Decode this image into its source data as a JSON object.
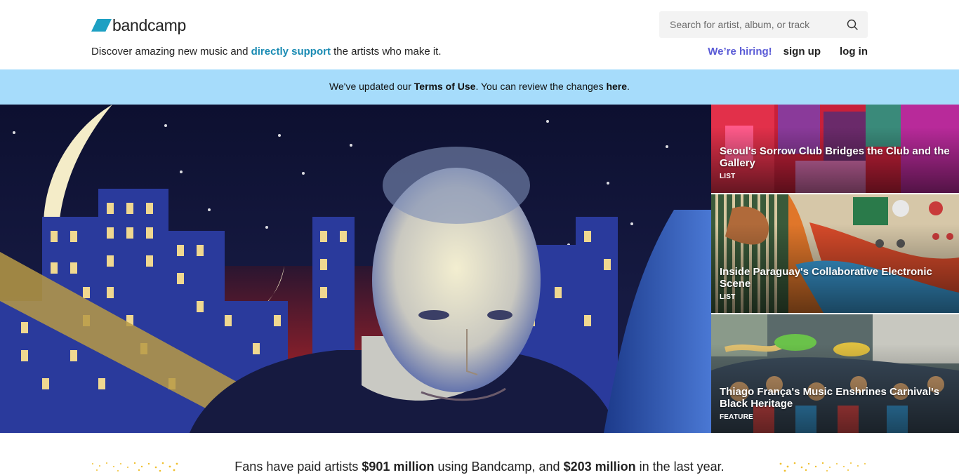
{
  "brand": {
    "name": "bandcamp",
    "accent": "#1da0c3"
  },
  "header": {
    "tagline_pre": "Discover amazing new music and ",
    "tagline_link": "directly support",
    "tagline_post": " the artists who make it.",
    "search_placeholder": "Search for artist, album, or track",
    "nav": {
      "hiring": "We’re hiring!",
      "signup": "sign up",
      "login": "log in"
    }
  },
  "notice": {
    "pre": "We've updated our ",
    "terms_link": "Terms of Use",
    "mid": ". You can review the changes ",
    "here_link": "here",
    "post": "."
  },
  "stories": [
    {
      "title": "Seoul's Sorrow Club Bridges the Club and the Gallery",
      "tag": "LIST"
    },
    {
      "title": "Inside Paraguay's Collaborative Electronic Scene",
      "tag": "LIST"
    },
    {
      "title": "Thiago França's Music Enshrines Carnival's Black Heritage",
      "tag": "FEATURE"
    }
  ],
  "stats": {
    "pre": "Fans have paid artists ",
    "total": "$901 million",
    "mid": " using Bandcamp, and ",
    "year": "$203 million",
    "post": " in the last year."
  }
}
